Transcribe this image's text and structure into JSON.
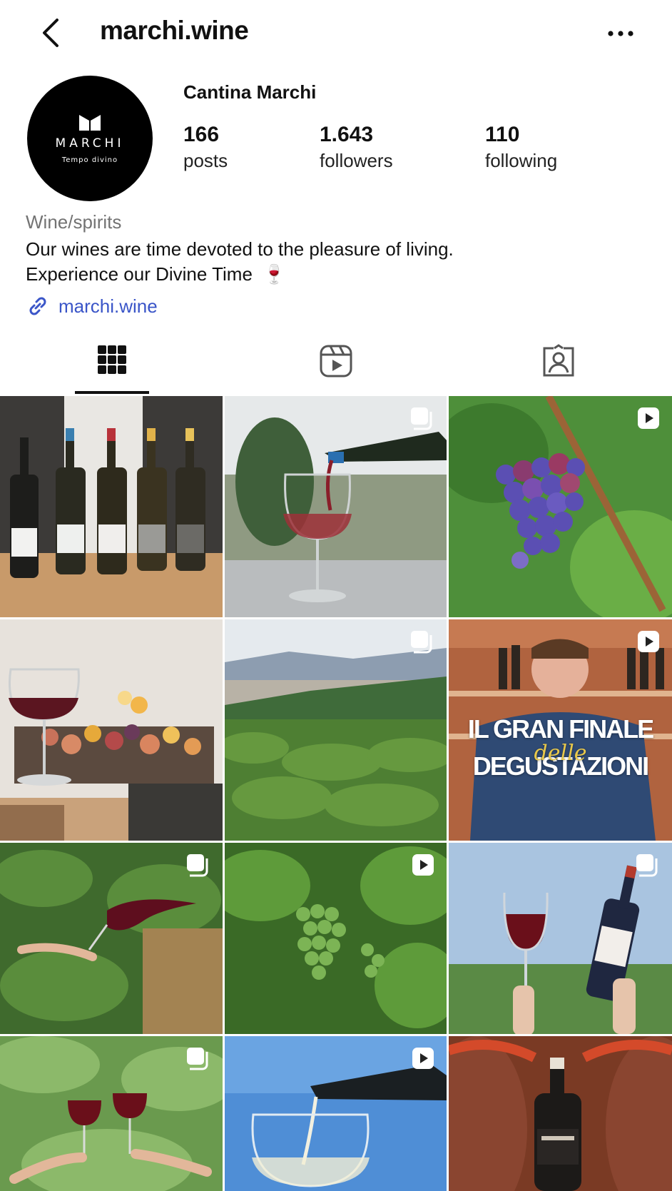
{
  "header": {
    "username": "marchi.wine"
  },
  "profile": {
    "avatar_brand": "MARCHI",
    "avatar_tagline": "Tempo divino",
    "display_name": "Cantina Marchi",
    "stats": [
      {
        "value": "166",
        "label": "posts"
      },
      {
        "value": "1.643",
        "label": "followers"
      },
      {
        "value": "110",
        "label": "following"
      }
    ],
    "category": "Wine/spirits",
    "bio_line1": "Our wines are time devoted to the pleasure of living.",
    "bio_line2": "Experience our Divine Time",
    "bio_emoji": "🍷",
    "website": "marchi.wine"
  },
  "tabs": [
    {
      "icon": "grid-icon",
      "active": true
    },
    {
      "icon": "reels-icon",
      "active": false
    },
    {
      "icon": "tagged-icon",
      "active": false
    }
  ],
  "posts": [
    {
      "type": "photo",
      "subject": "wine-bottles-lineup"
    },
    {
      "type": "carousel",
      "subject": "pouring-red-wine"
    },
    {
      "type": "reel",
      "subject": "grape-bunch"
    },
    {
      "type": "photo",
      "subject": "wine-and-charcuterie"
    },
    {
      "type": "carousel",
      "subject": "vineyard-landscape"
    },
    {
      "type": "reel",
      "subject": "tasting-video",
      "overlay_line1": "IL GRAN FINALE",
      "overlay_script": "delle",
      "overlay_line2": "DEGUSTAZIONI"
    },
    {
      "type": "carousel",
      "subject": "wine-splash-vineyard"
    },
    {
      "type": "reel",
      "subject": "green-grapes"
    },
    {
      "type": "carousel",
      "subject": "toast-glass-and-bottle"
    },
    {
      "type": "carousel",
      "subject": "cheers-glasses"
    },
    {
      "type": "reel",
      "subject": "pouring-white-wine"
    },
    {
      "type": "photo",
      "subject": "bottle-in-cellar"
    }
  ]
}
